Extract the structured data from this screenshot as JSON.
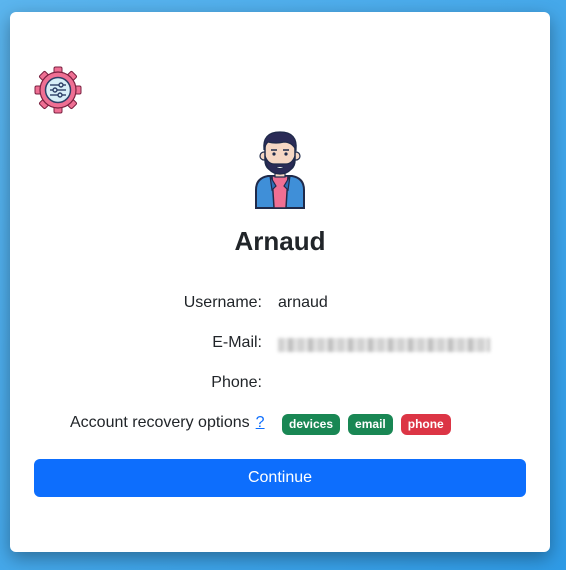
{
  "user": {
    "display_name": "Arnaud",
    "username": "arnaud"
  },
  "fields": {
    "username_label": "Username:",
    "email_label": "E-Mail:",
    "phone_label": "Phone:",
    "recovery_label": "Account recovery options",
    "help_link": "?"
  },
  "recovery_options": [
    "devices",
    "email",
    "phone"
  ],
  "actions": {
    "continue_label": "Continue"
  },
  "icons": {
    "settings": "gear-sliders-icon",
    "avatar": "bearded-man-avatar"
  },
  "colors": {
    "primary": "#0d6efd",
    "badge_green": "#198754",
    "badge_red": "#dc3545",
    "gear_pink": "#ef6f93"
  }
}
